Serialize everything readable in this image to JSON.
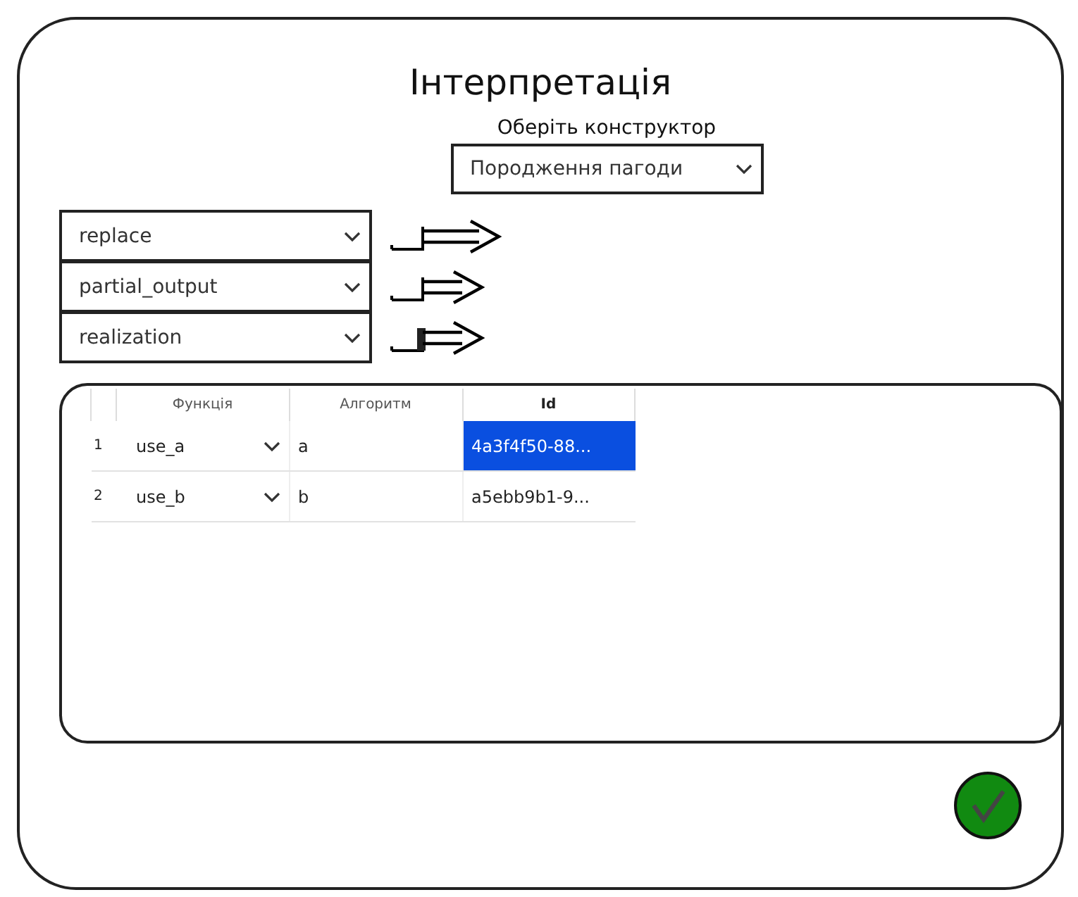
{
  "title": "Інтерпретація",
  "constructor": {
    "label": "Оберіть конструктор",
    "value": "Породження пагоди"
  },
  "selectors": [
    {
      "value": "replace"
    },
    {
      "value": "partial_output"
    },
    {
      "value": "realization"
    }
  ],
  "table": {
    "columns": [
      "Функція",
      "Алгоритм",
      "Id"
    ],
    "rows": [
      {
        "number": "1",
        "function": "use_a",
        "algorithm": "a",
        "id": "4a3f4f50-88...",
        "selected": true
      },
      {
        "number": "2",
        "function": "use_b",
        "algorithm": "b",
        "id": "a5ebb9b1-9...",
        "selected": false
      }
    ]
  }
}
